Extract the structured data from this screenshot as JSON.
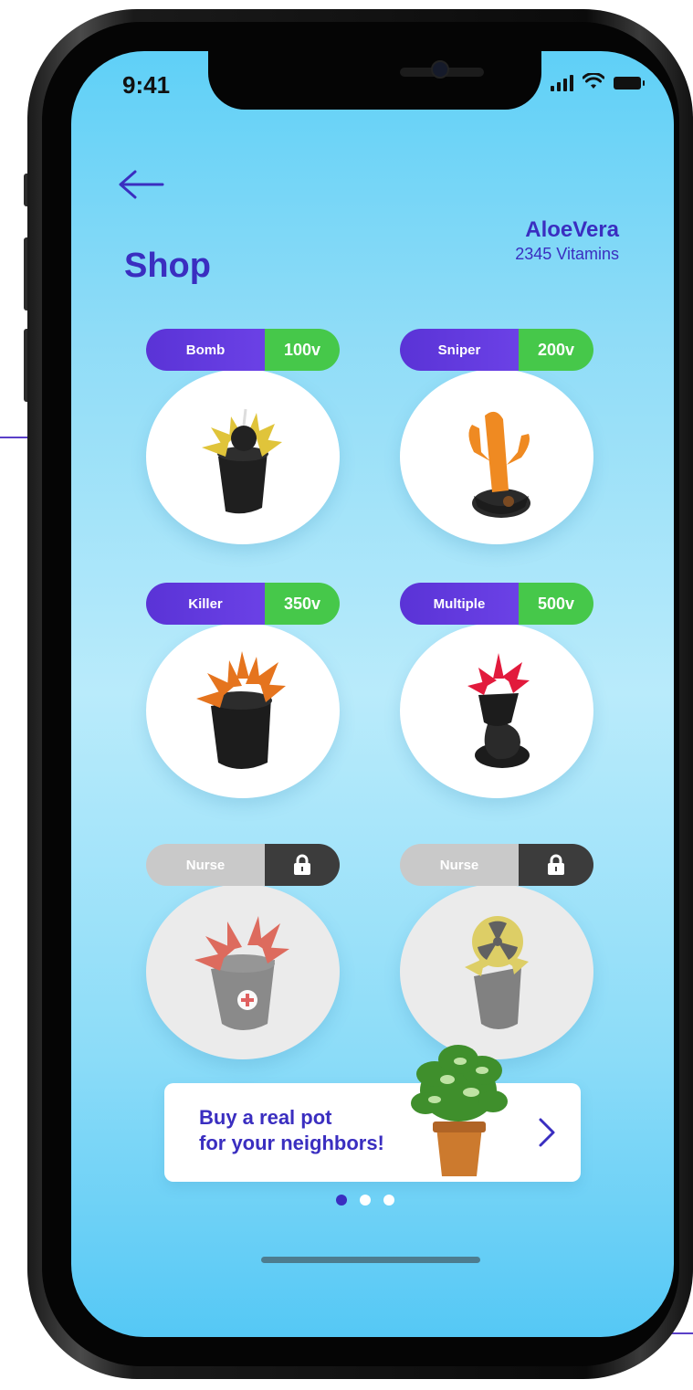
{
  "status_bar": {
    "time": "9:41"
  },
  "header": {
    "back_icon": "arrow-left-icon",
    "title": "Shop",
    "user_name": "AloeVera",
    "user_vitamins": "2345 Vitamins"
  },
  "items": [
    {
      "name": "Bomb",
      "price": "100v",
      "locked": false
    },
    {
      "name": "Sniper",
      "price": "200v",
      "locked": false
    },
    {
      "name": "Killer",
      "price": "350v",
      "locked": false
    },
    {
      "name": "Multiple",
      "price": "500v",
      "locked": false
    },
    {
      "name": "Nurse",
      "price": "",
      "locked": true,
      "icon": "lock-icon"
    },
    {
      "name": "Nurse",
      "price": "",
      "locked": true,
      "icon": "lock-icon"
    }
  ],
  "banner": {
    "line1": "Buy a real pot",
    "line2": "for your neighbors!",
    "icon": "chevron-right-icon"
  },
  "pagination": {
    "total": 3,
    "active": 1
  },
  "colors": {
    "accent_purple": "#3a2ec0",
    "price_green": "#46c84a",
    "locked_dark": "#3c3c3c",
    "locked_gray": "#c9c9c9"
  }
}
